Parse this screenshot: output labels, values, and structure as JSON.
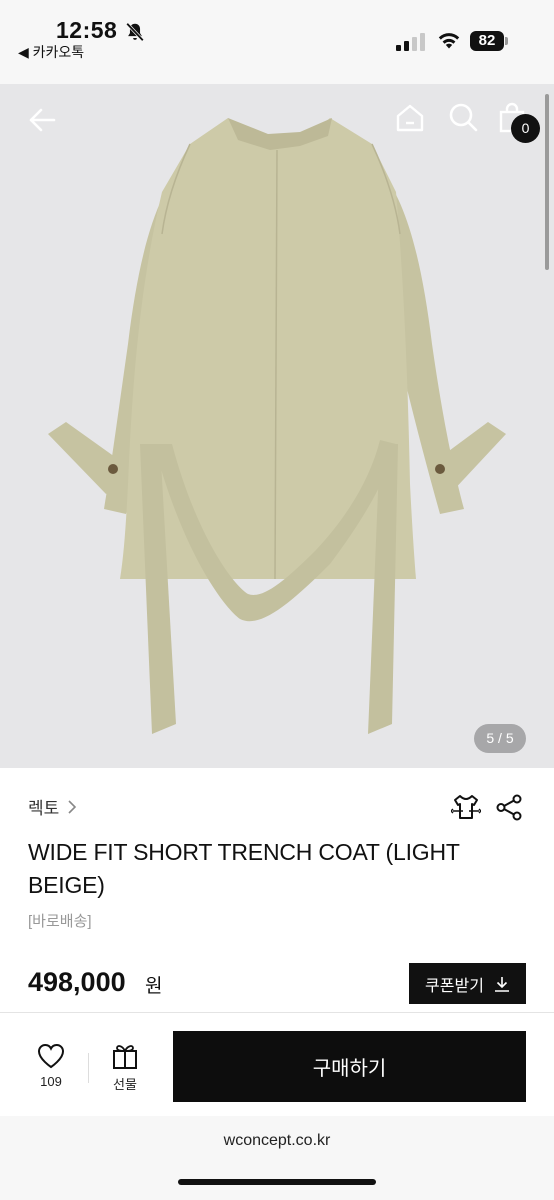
{
  "status_bar": {
    "time": "12:58",
    "back_app": "◀ 카카오톡",
    "battery": "82"
  },
  "gallery": {
    "counter": "5 / 5",
    "cart_count": "0",
    "image_description": "light beige short trench coat, back view"
  },
  "product": {
    "brand": "렉토",
    "title": "WIDE FIT SHORT TRENCH COAT (LIGHT BEIGE)",
    "shipping": "[바로배송]",
    "price": "498,000",
    "price_unit": "원",
    "coupon_label": "쿠폰받기"
  },
  "action_bar": {
    "like_count": "109",
    "gift_label": "선물",
    "buy_label": "구매하기"
  },
  "browser": {
    "url": "wconcept.co.kr"
  },
  "colors": {
    "coat": "#c9c6a4",
    "background": "#e6e6e8",
    "button": "#0d0d0d"
  }
}
